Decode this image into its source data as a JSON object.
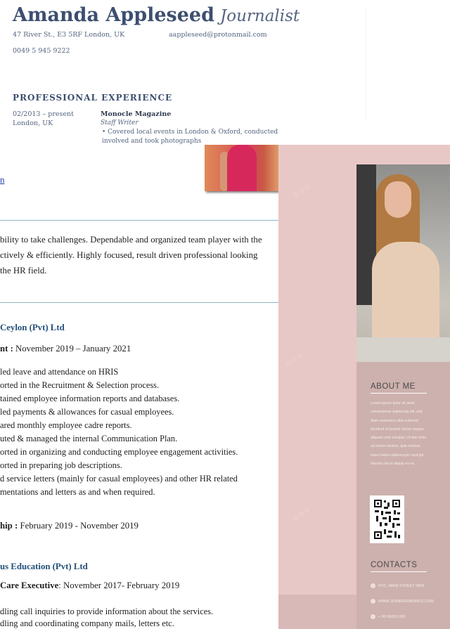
{
  "top_resume": {
    "name": "Amanda Appleseed",
    "role": "Journalist",
    "address": "47 River St., E3 5RF London, UK",
    "email": "aappleseed@protonmail.com",
    "phone": "0049 5 945 9222",
    "section_title": "PROFESSIONAL EXPERIENCE",
    "job": {
      "period": "02/2013 – present",
      "location": "London, UK",
      "employer": "Monocle Magazine",
      "position": "Staff Writer",
      "bullet": "Covered local events in London & Oxford, conducted involved and took photographs"
    }
  },
  "mid_resume": {
    "link_fragment": "n",
    "summary_lines": [
      "bility to take challenges. Dependable and organized team player with the",
      "ctively & efficiently. Highly focused, result driven professional looking",
      " the HR field."
    ],
    "org1": "Ceylon (Pvt) Ltd",
    "period1_label": "nt :",
    "period1_value": " November 2019 – January 2021",
    "duties1": [
      "led leave and attendance on HRIS",
      "orted in the Recruitment & Selection process.",
      "tained employee information reports and databases.",
      "led payments & allowances for casual employees.",
      "ared monthly employee cadre reports.",
      "uted & managed the internal Communication Plan.",
      "orted in organizing and conducting employee engagement activities.",
      "orted in preparing job descriptions.",
      "d  service  letters  (mainly  for  casual  employees)  and  other  HR  related",
      "mentations and letters as and when required."
    ],
    "period2_label": "hip :",
    "period2_value": " February 2019 - November 2019",
    "org2": "us Education (Pvt) Ltd",
    "period3_label": "Care Executive",
    "period3_value": ": November 2017- February 2019",
    "duties3": [
      "dling call inquiries to provide information about the services.",
      "dling and coordinating company mails, letters etc."
    ]
  },
  "pink_resume": {
    "about_title": "ABOUT ME",
    "about_lines": [
      "Lorem ipsum dolor sit amet,",
      "consectetuer adipiscing elit, sed",
      "diam nonummy nibh euismod",
      "tincidunt ut laoreet dolore magna",
      "aliquam erat volutpat. Ut wisi enim",
      "ad minim veniam, quis nostrud",
      "exerci tation ullamcorper suscipit",
      "lobortis nisl ut aliquip ex ea"
    ],
    "contacts_title": "CONTACTS",
    "contacts": [
      {
        "icon": "location-pin-icon",
        "text": "NYC, MAIN STREET 0808"
      },
      {
        "icon": "globe-icon",
        "text": "WWW.JENNIFERWORKS.COM"
      },
      {
        "icon": "phone-icon",
        "text": "+ 00 00000 000"
      }
    ]
  }
}
